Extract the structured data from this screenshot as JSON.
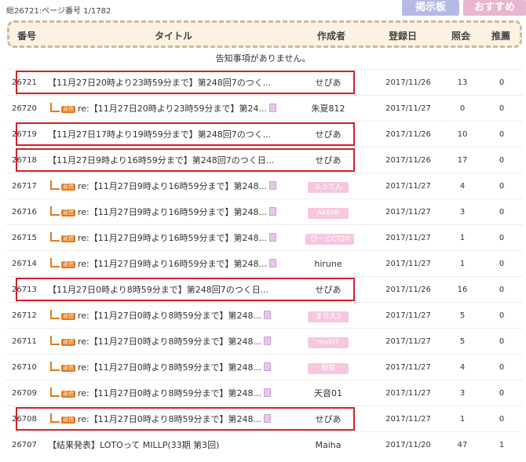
{
  "topbar": {
    "total_text": "総26721:ページ番号 1/1782",
    "bbs_button": "掲示板",
    "recommend_button": "おすすめ"
  },
  "columns": {
    "number": "番号",
    "title": "タイトル",
    "author": "作成者",
    "date": "登録日",
    "views": "照会",
    "recommend": "推薦"
  },
  "notice": "告知事項がありません。",
  "reply_badge": "返信",
  "rows": [
    {
      "number": "26721",
      "title": "【11月27日20時より23時59分まで】第248回7のつく...",
      "author": "せぴあ",
      "date": "2017/11/26",
      "views": "13",
      "rec": "0"
    },
    {
      "number": "26720",
      "title": "re:【11月27日20時より23時59分まで】第24...",
      "author": "朱夏812",
      "date": "2017/11/27",
      "views": "0",
      "rec": "0"
    },
    {
      "number": "26719",
      "title": "【11月27日17時より19時59分まで】第248回7のつく...",
      "author": "せぴあ",
      "date": "2017/11/26",
      "views": "10",
      "rec": "0"
    },
    {
      "number": "26718",
      "title": "【11月27日9時より16時59分まで】第248回7のつく日...",
      "author": "せぴあ",
      "date": "2017/11/26",
      "views": "17",
      "rec": "0"
    },
    {
      "number": "26717",
      "title": "re:【11月27日9時より16時59分まで】第248...",
      "author": "ふうてん",
      "date": "2017/11/27",
      "views": "4",
      "rec": "0"
    },
    {
      "number": "26716",
      "title": "re:【11月27日9時より16時59分まで】第248...",
      "author": "AKEMI",
      "date": "2017/11/27",
      "views": "3",
      "rec": "0"
    },
    {
      "number": "26715",
      "title": "re:【11月27日9時より16時59分まで】第248...",
      "author": "ひーとCT20",
      "date": "2017/11/27",
      "views": "1",
      "rec": "0"
    },
    {
      "number": "26714",
      "title": "re:【11月27日9時より16時59分まで】第248...",
      "author": "hirune",
      "date": "2017/11/27",
      "views": "1",
      "rec": "0"
    },
    {
      "number": "26713",
      "title": "【11月27日0時より8時59分まで】第248回7のつく日...",
      "author": "せぴあ",
      "date": "2017/11/26",
      "views": "16",
      "rec": "0"
    },
    {
      "number": "26712",
      "title": "re:【11月27日0時より8時59分まで】第248...",
      "author": "まりえ5",
      "date": "2017/11/27",
      "views": "5",
      "rec": "0"
    },
    {
      "number": "26711",
      "title": "re:【11月27日0時より8時59分まで】第248...",
      "author": "maki7",
      "date": "2017/11/27",
      "views": "5",
      "rec": "0"
    },
    {
      "number": "26710",
      "title": "re:【11月27日0時より8時59分まで】第248...",
      "author": "和草",
      "date": "2017/11/27",
      "views": "4",
      "rec": "0"
    },
    {
      "number": "26709",
      "title": "re:【11月27日0時より8時59分まで】第248...",
      "author": "天音01",
      "date": "2017/11/27",
      "views": "3",
      "rec": "0"
    },
    {
      "number": "26708",
      "title": "re:【11月27日0時より8時59分まで】第248...",
      "author": "せぴあ",
      "date": "2017/11/27",
      "views": "1",
      "rec": "0"
    },
    {
      "number": "26707",
      "title": "【結果発表】LOTOって MILLP(33期 第3回)",
      "author": "Maiha",
      "date": "2017/11/20",
      "views": "47",
      "rec": "1"
    }
  ]
}
